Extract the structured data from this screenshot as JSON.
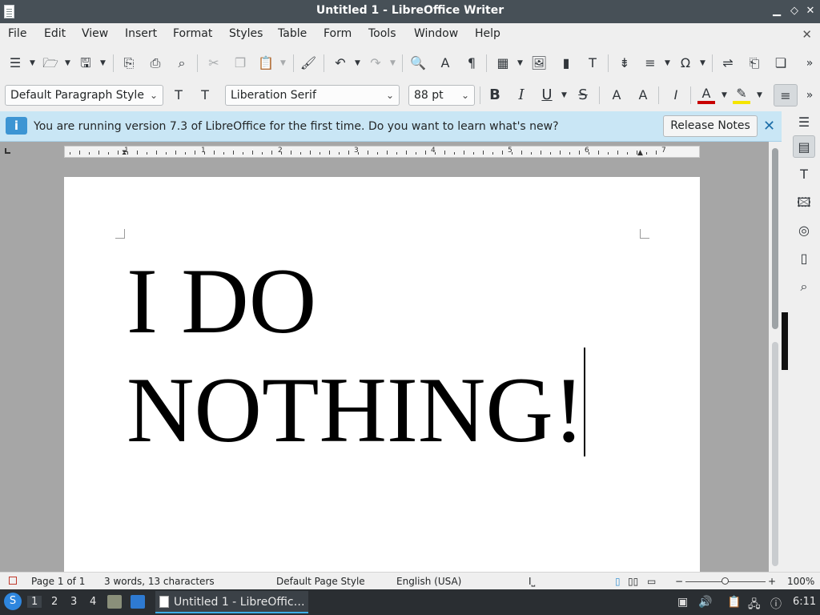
{
  "window": {
    "title": "Untitled 1 - LibreOffice Writer"
  },
  "menu": [
    "File",
    "Edit",
    "View",
    "Insert",
    "Format",
    "Styles",
    "Table",
    "Form",
    "Tools",
    "Window",
    "Help"
  ],
  "formatting": {
    "paragraph_style": "Default Paragraph Style",
    "font_name": "Liberation Serif",
    "font_size": "88 pt"
  },
  "infobar": {
    "message": "You are running version 7.3 of LibreOffice for the first time. Do you want to learn what's new?",
    "button_label": "Release Notes"
  },
  "ruler": {
    "labels": [
      "1",
      "1",
      "2",
      "3",
      "4",
      "5",
      "6",
      "7"
    ]
  },
  "document": {
    "line1": "I DO",
    "line2": "NOTHING!"
  },
  "statusbar": {
    "page": "Page 1 of 1",
    "word_count": "3 words, 13 characters",
    "page_style": "Default Page Style",
    "language": "English (USA)",
    "zoom": "100%",
    "zoom_minus": "−",
    "zoom_plus": "+"
  },
  "taskbar": {
    "workspaces": [
      "1",
      "2",
      "3",
      "4"
    ],
    "task_title": "Untitled 1 - LibreOffic…",
    "clock": "6:11"
  },
  "colors": {
    "titlebar": "#475057",
    "infobar": "#c9e6f5",
    "accent": "#3daee9"
  }
}
